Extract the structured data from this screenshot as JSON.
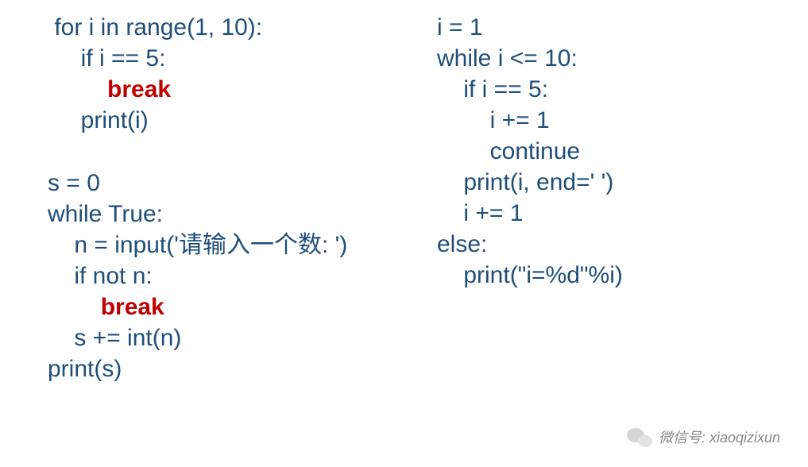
{
  "left": {
    "block1": {
      "l1": " for i in range(1, 10):",
      "l2": "     if i == 5:",
      "l3_indent": "         ",
      "l3_kw": "break",
      "l4": "     print(i)"
    },
    "block2": {
      "l1": "s = 0",
      "l2": "while True:",
      "l3": "    n = input('请输入一个数: ')",
      "l4": "    if not n:",
      "l5_indent": "        ",
      "l5_kw": "break",
      "l6": "    s += int(n)",
      "l7": "print(s)"
    }
  },
  "right": {
    "l1": "i = 1",
    "l2": "while i <= 10:",
    "l3": "    if i == 5:",
    "l4": "        i += 1",
    "l5": "        continue",
    "l6": "    print(i, end=' ')",
    "l7": "    i += 1",
    "l8": "else:",
    "l9": "    print(\"i=%d\"%i)"
  },
  "watermark": {
    "text": "微信号: xiaoqizixun"
  }
}
